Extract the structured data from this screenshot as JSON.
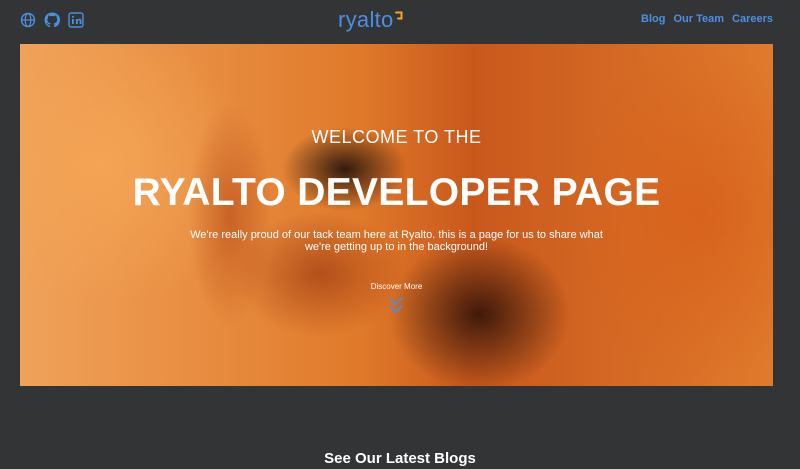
{
  "header": {
    "social_icons": [
      "globe-icon",
      "github-icon",
      "linkedin-icon"
    ],
    "logo_text": "ryalto",
    "nav": [
      {
        "label": "Blog"
      },
      {
        "label": "Our Team"
      },
      {
        "label": "Careers"
      }
    ]
  },
  "hero": {
    "eyebrow": "WELCOME TO THE",
    "headline": "RYALTO DEVELOPER PAGE",
    "tagline": "We're really proud of our tack team here at Ryalto. this is a page for us to share what we're getting up to in the background!",
    "discover_label": "Discover More",
    "discover_icon": "double-chevron-down-icon"
  },
  "blogs": {
    "title": "See Our Latest Blogs"
  },
  "colors": {
    "background": "#333435",
    "accent": "#4a90e2",
    "logo_mark": "#f5a623",
    "hero_base": "#d2691e",
    "text": "#ffffff"
  }
}
